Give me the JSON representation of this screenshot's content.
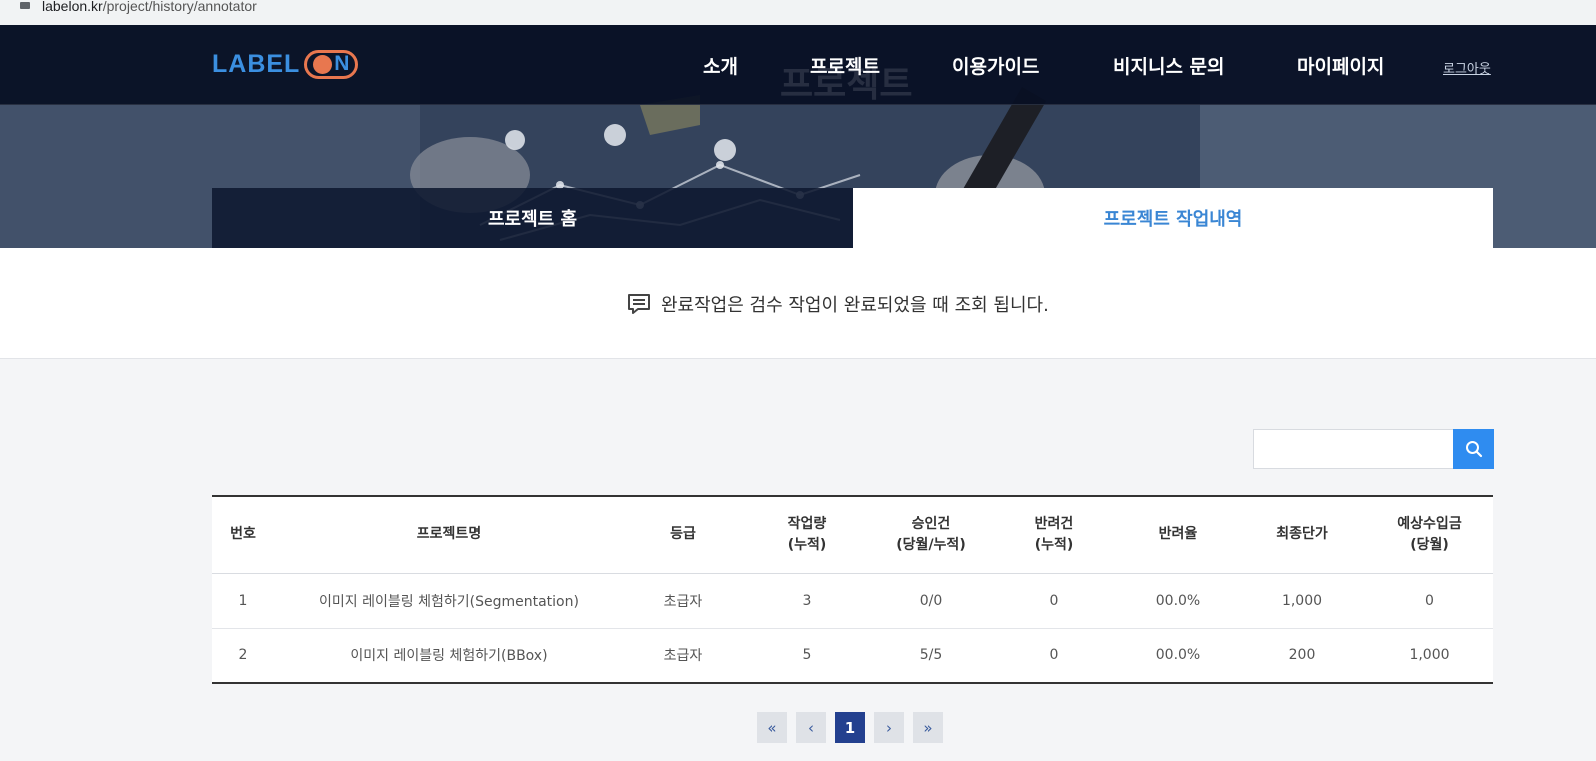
{
  "browser": {
    "url_domain": "labelon.kr",
    "url_path": "/project/history/annotator",
    "lock_icon": "lock-icon"
  },
  "header": {
    "logo_text": "LABEL",
    "logo_on": "N",
    "ghost_title": "프로젝트",
    "nav": [
      "소개",
      "프로젝트",
      "이용가이드",
      "비지니스 문의",
      "마이페이지"
    ],
    "logout": "로그아웃"
  },
  "tabs": {
    "home": "프로젝트 홈",
    "history": "프로젝트 작업내역"
  },
  "notice": {
    "icon": "message-icon",
    "text": "완료작업은 검수 작업이 완료되었을 때 조회 됩니다."
  },
  "search": {
    "placeholder": "",
    "value": "",
    "icon": "search-icon"
  },
  "table": {
    "headers": [
      {
        "line1": "번호",
        "line2": ""
      },
      {
        "line1": "프로젝트명",
        "line2": ""
      },
      {
        "line1": "등급",
        "line2": ""
      },
      {
        "line1": "작업량",
        "line2": "(누적)"
      },
      {
        "line1": "승인건",
        "line2": "(당월/누적)"
      },
      {
        "line1": "반려건",
        "line2": "(누적)"
      },
      {
        "line1": "반려율",
        "line2": ""
      },
      {
        "line1": "최종단가",
        "line2": ""
      },
      {
        "line1": "예상수입금",
        "line2": "(당월)"
      }
    ],
    "rows": [
      [
        "1",
        "이미지 레이블링 체험하기(Segmentation)",
        "초급자",
        "3",
        "0/0",
        "0",
        "00.0%",
        "1,000",
        "0"
      ],
      [
        "2",
        "이미지 레이블링 체험하기(BBox)",
        "초급자",
        "5",
        "5/5",
        "0",
        "00.0%",
        "200",
        "1,000"
      ]
    ]
  },
  "pagination": {
    "first": "«",
    "prev": "‹",
    "current": "1",
    "next": "›",
    "last": "»"
  },
  "colors": {
    "accent": "#2f8cf0",
    "tab_active_text": "#3a86d4",
    "nav_bg": "#070f23",
    "logo_orange": "#e8774f",
    "logo_blue": "#3b8fe0",
    "page_active": "#23408f"
  }
}
